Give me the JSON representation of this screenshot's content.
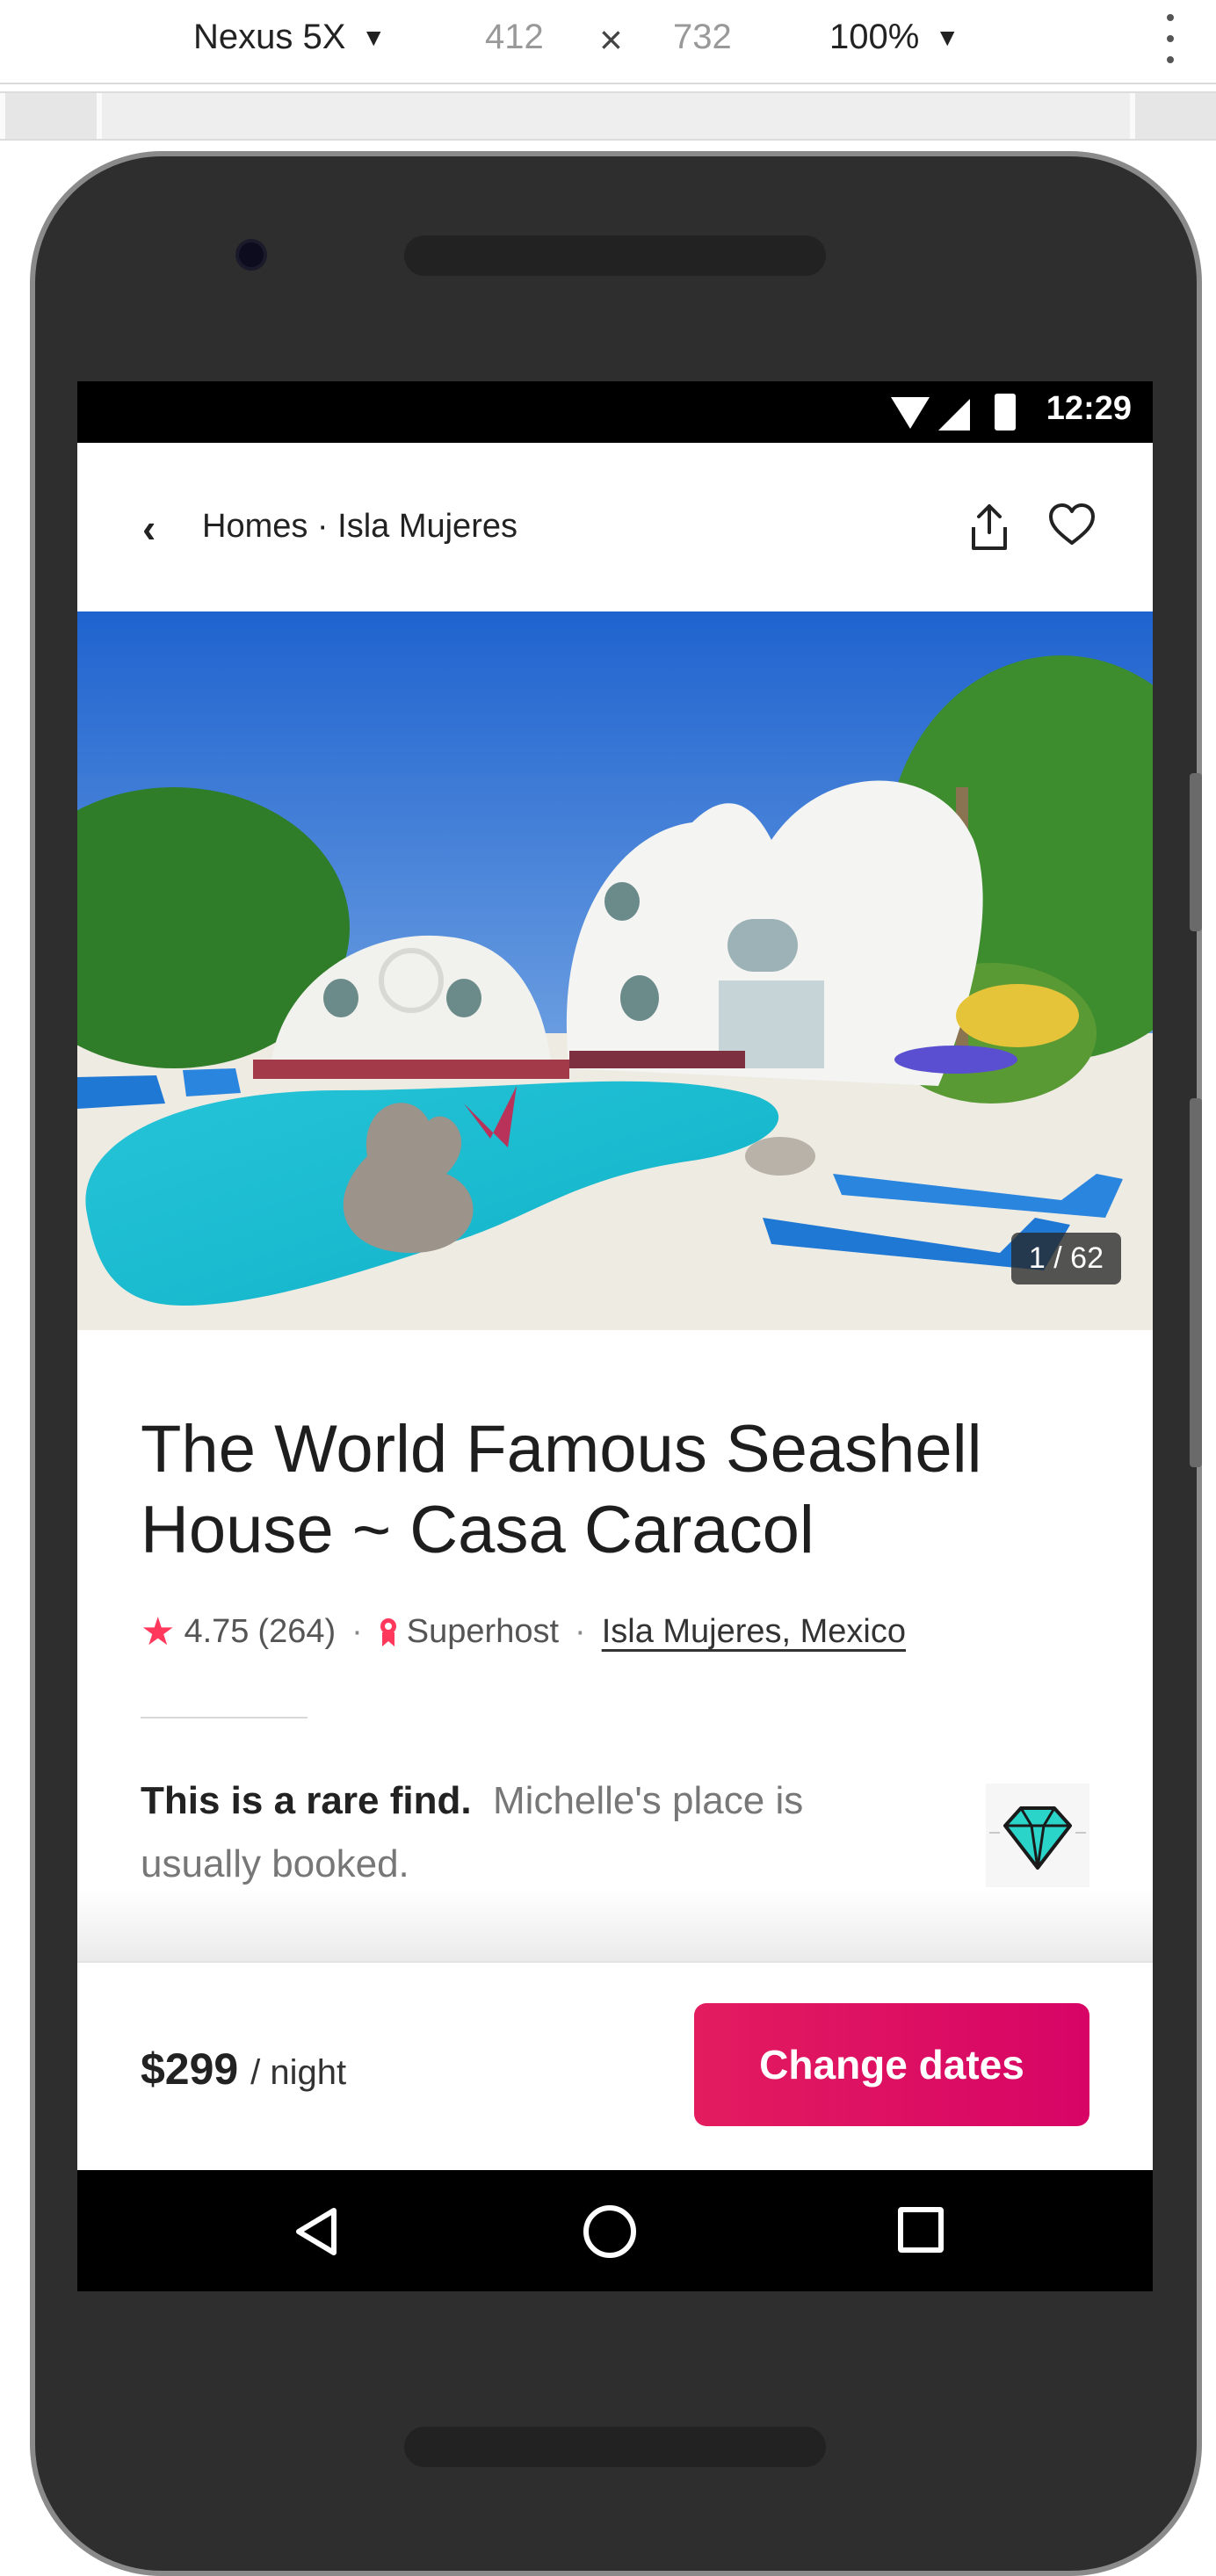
{
  "devtools": {
    "device": "Nexus 5X",
    "width": "412",
    "times": "×",
    "height": "732",
    "zoom": "100%"
  },
  "status_bar": {
    "time": "12:29"
  },
  "app_bar": {
    "breadcrumb": "Homes · Isla Mujeres"
  },
  "hero": {
    "photo_counter": "1 / 62"
  },
  "listing": {
    "title": "The World Famous Seashell House ~ Casa Caracol",
    "rating": "4.75",
    "review_count": "(264)",
    "superhost": "Superhost",
    "location": "Isla Mujeres, Mexico",
    "rare_bold": "This is a rare find.",
    "rare_text": "Michelle's place is usually booked."
  },
  "booking": {
    "price": "$299",
    "per_night": "/ night",
    "cta": "Change dates"
  },
  "colors": {
    "accent": "#e31c5f",
    "star": "#ff385c",
    "gem": "#2ad4c8"
  }
}
